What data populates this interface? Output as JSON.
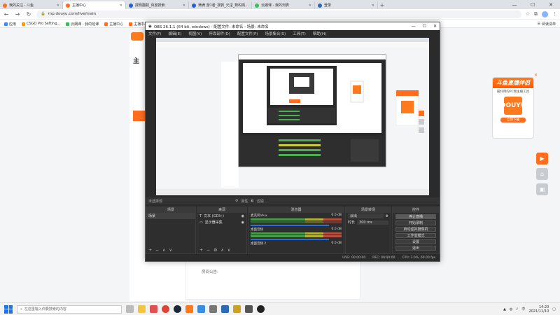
{
  "browser": {
    "tabs": [
      {
        "label": "我的关注 - 斗鱼",
        "color": "#ff6d1f"
      },
      {
        "label": "主播中心",
        "color": "#ff6d1f",
        "active": true
      },
      {
        "label": "搜狗翻载_百度搜索",
        "color": "#2e5bdb"
      },
      {
        "label": "满满 游1者_搜狗_元宝_数码购...",
        "color": "#2e5bdb"
      },
      {
        "label": "云朗课 - 我的列表",
        "color": "#3dbb5e"
      },
      {
        "label": "登录",
        "color": "#2b6cb0"
      }
    ],
    "url": "mp.douyu.com/live/main",
    "bookmarks": [
      {
        "label": "应用",
        "color": "#4285f4"
      },
      {
        "label": "CSGO Pro Setting...",
        "color": "#ff9800"
      },
      {
        "label": "云朗课 - 我的班课",
        "color": "#3dbb5e"
      },
      {
        "label": "主播中心",
        "color": "#ff6d1f"
      },
      {
        "label": "主播中心",
        "color": "#ff6d1f"
      }
    ],
    "bookmarks_right": "阅读清单"
  },
  "page": {
    "heading": "主",
    "announcement_label": "房间公告:"
  },
  "promo": {
    "title": "斗鱼直播伴侣",
    "subtitle": "最好用的PC端主播工具",
    "box_text": "DOUYU",
    "button": "立即下载"
  },
  "obs": {
    "title": "OBS 26.1.1 (64 bit, windows) - 配置文件: 未命名 - 场景: 未命名",
    "menu": [
      "文件(F)",
      "编辑(E)",
      "视图(V)",
      "停靠部件(D)",
      "配置文件(P)",
      "场景集合(S)",
      "工具(T)",
      "帮助(H)"
    ],
    "source_label": "未选择源",
    "props_label": "属性",
    "filters_label": "滤镜",
    "docks": {
      "scenes": {
        "title": "场景",
        "items": [
          "场景"
        ]
      },
      "sources": {
        "title": "来源",
        "items": [
          "文本 (GDI+)",
          "显示器采集"
        ]
      },
      "mixer": {
        "title": "混音器",
        "tracks": [
          {
            "name": "麦克风/Aux",
            "db": "0.0 dB"
          },
          {
            "name": "桌面音频",
            "db": "0.0 dB"
          },
          {
            "name": "桌面音频 2",
            "db": "0.0 dB"
          }
        ]
      },
      "transitions": {
        "title": "场景转场",
        "type": "淡出",
        "duration_label": "时长",
        "duration": "300 ms"
      },
      "controls": {
        "title": "控件",
        "buttons": [
          "停止直播",
          "开始录制",
          "启动虚拟摄像机",
          "工作室模式",
          "设置",
          "退出"
        ]
      }
    },
    "status": {
      "live": "LIVE: 00:00:00",
      "rec": "REC: 00:00:00",
      "cpu": "CPU: 3.0%, 60.00 fps"
    }
  },
  "taskbar": {
    "search_placeholder": "在这里输入你要搜索的内容",
    "time": "14:20",
    "date": "2021/11/10"
  }
}
